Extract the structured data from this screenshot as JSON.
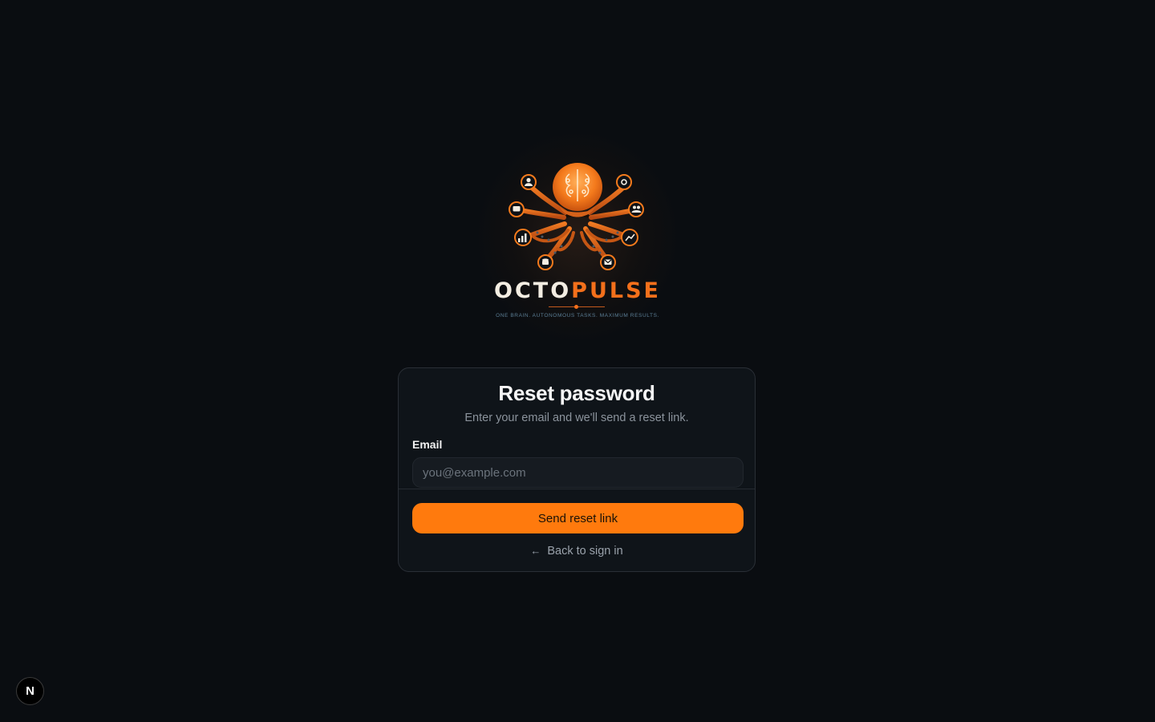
{
  "brand": {
    "name_part1": "OCTO",
    "name_part2": "PULSE",
    "tagline": "ONE BRAIN. AUTONOMOUS TASKS. MAXIMUM RESULTS.",
    "colors": {
      "accent": "#f4701b",
      "text": "#f3ede2",
      "tagline": "#5c7f96"
    },
    "icons": [
      "user-icon",
      "gear-icon",
      "chat-icon",
      "users-icon",
      "bar-chart-icon",
      "trend-icon",
      "database-icon",
      "mail-icon",
      "brain-icon"
    ]
  },
  "card": {
    "title": "Reset password",
    "subtitle": "Enter your email and we'll send a reset link.",
    "email_label": "Email",
    "email_value": "",
    "email_placeholder": "you@example.com",
    "submit_label": "Send reset link",
    "back_arrow": "←",
    "back_label": "Back to sign in"
  },
  "badge": {
    "label": "N",
    "icon": "nextjs-icon"
  },
  "colors": {
    "background": "#0a0d11",
    "card": "#0f1419",
    "primary_button": "#ff7a0d"
  }
}
